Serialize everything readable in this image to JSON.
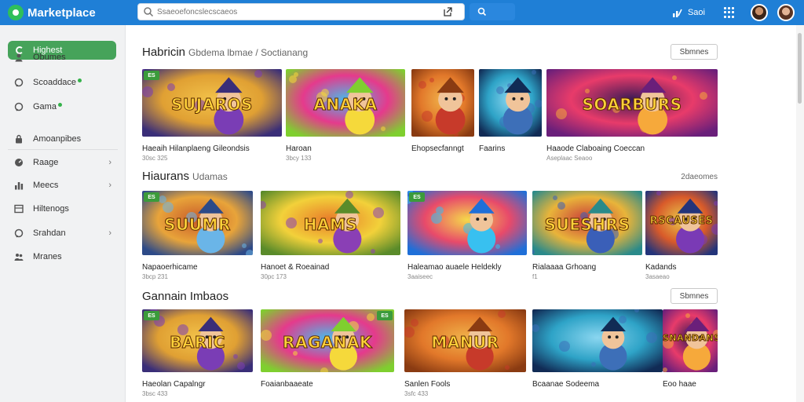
{
  "header": {
    "brand": "Marketplace",
    "search_placeholder": "Ssaeoefoncslecscaeos",
    "stats_label": "Saoi"
  },
  "sidebar": {
    "active": "Highest",
    "items": [
      {
        "label": "Obumes",
        "icon": "person-icon",
        "dot": false,
        "chevron": false
      },
      {
        "label": "Scoaddace",
        "icon": "chat-icon",
        "dot": true,
        "chevron": false
      },
      {
        "label": "Gama",
        "icon": "chat-icon",
        "dot": true,
        "chevron": false
      },
      {
        "label": "Amoanpibes",
        "icon": "lock-icon",
        "dot": false,
        "chevron": false
      },
      {
        "label": "Raage",
        "icon": "gauge-icon",
        "dot": false,
        "chevron": true
      },
      {
        "label": "Meecs",
        "icon": "bar-chart-icon",
        "dot": false,
        "chevron": true
      },
      {
        "label": "Hiltenogs",
        "icon": "list-icon",
        "dot": false,
        "chevron": false
      },
      {
        "label": "Srahdan",
        "icon": "chat-icon",
        "dot": false,
        "chevron": true
      },
      {
        "label": "Mranes",
        "icon": "user-group-icon",
        "dot": false,
        "chevron": false
      }
    ]
  },
  "sections": [
    {
      "title": "Habricin",
      "subtitle": "Gbdema lbmae / Soctianang",
      "button": "Sbmnes",
      "cards": [
        {
          "title": "Haeaih Hilanplaeng Gileondsis",
          "meta": "30sc 325",
          "art": "SUJAROS",
          "badge": "ES"
        },
        {
          "title": "Haroan",
          "meta": "3bcy 133",
          "art": "ANAKA",
          "badge": ""
        },
        {
          "title": "Ehopsecfanngt",
          "meta": "",
          "art": "",
          "badge": ""
        },
        {
          "title": "Faarins",
          "meta": "",
          "art": "",
          "badge": ""
        },
        {
          "title": "Haaode Claboaing Coeccan",
          "meta": "Aseplaac Seaoo",
          "art": "SOARBURS",
          "badge": ""
        }
      ]
    },
    {
      "title": "Hiaurans",
      "subtitle": "Udamas",
      "link": "2daeomes",
      "cards": [
        {
          "title": "Napaoerhicame",
          "meta": "3bcp 231",
          "art": "SUUMR",
          "badge": "ES"
        },
        {
          "title": "Hanoet & Roeainad",
          "meta": "30pc 173",
          "art": "HAMS",
          "badge": ""
        },
        {
          "title": "Haleamao auaele Heldekly",
          "meta": "3aaiseec",
          "art": "",
          "badge": "ES"
        },
        {
          "title": "Rialaaaa Grhoang",
          "meta": "f1",
          "art": "SUESHRS",
          "badge": ""
        },
        {
          "title": "Kadands",
          "meta": "3asaeao",
          "art": "RSCAUSES",
          "badge": ""
        }
      ]
    },
    {
      "title": "Gannain Imbaos",
      "subtitle": "",
      "button": "Sbmnes",
      "cards": [
        {
          "title": "Haeolan Capalngr",
          "meta": "3bsc 433",
          "art": "BARIC",
          "badge": "ES"
        },
        {
          "title": "Foaianbaaeate",
          "meta": "",
          "art": "RAGANAK",
          "badge": "ES"
        },
        {
          "title": "Sanlen Fools",
          "meta": "3sfc 433",
          "art": "MANUR",
          "badge": ""
        },
        {
          "title": "Bcaanae Sodeema",
          "meta": "",
          "art": "",
          "badge": ""
        },
        {
          "title": "Eoo haae",
          "meta": "",
          "art": "SNANDANS",
          "badge": ""
        }
      ]
    }
  ],
  "colors": {
    "header": "#1f7fd6",
    "sidebar_active": "#46a35a",
    "online_dot": "#35b24a"
  }
}
